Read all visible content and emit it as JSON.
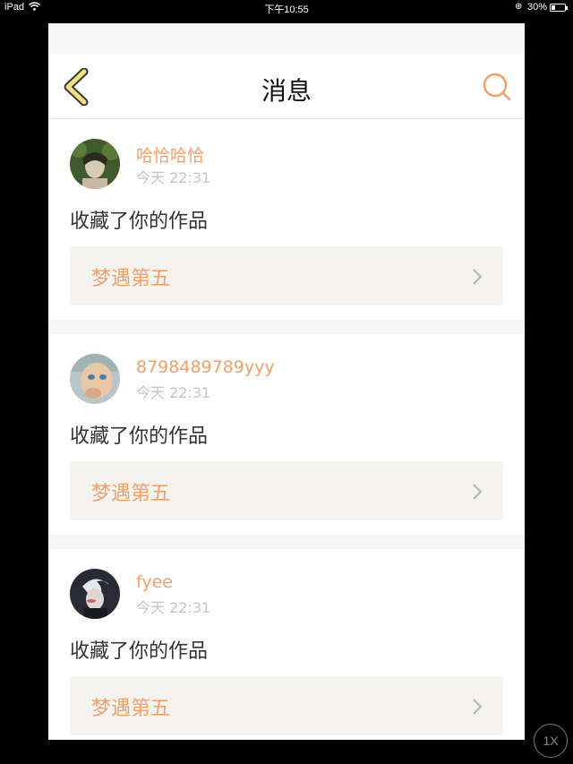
{
  "status_bar": {
    "device": "iPad",
    "time": "下午10:55",
    "battery_percent": "30%",
    "battery_level": 0.3
  },
  "header": {
    "title": "消息",
    "back_icon": "chevron-left-icon",
    "search_icon": "search-icon"
  },
  "colors": {
    "accent": "#f0a06a",
    "back_icon_fill": "#f2e080",
    "card_link_bg": "#f4f3ee"
  },
  "messages": [
    {
      "username": "哈恰哈恰",
      "timestamp": "今天 22:31",
      "action": "收藏了你的作品",
      "work_title": "梦遇第五"
    },
    {
      "username": "8798489789yyy",
      "timestamp": "今天 22:31",
      "action": "收藏了你的作品",
      "work_title": "梦遇第五"
    },
    {
      "username": "fyee",
      "timestamp": "今天 22:31",
      "action": "收藏了你的作品",
      "work_title": "梦遇第五"
    }
  ],
  "zoom": {
    "label": "1X"
  }
}
